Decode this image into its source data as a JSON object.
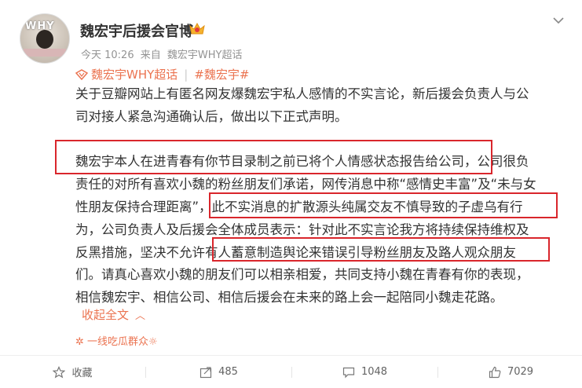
{
  "post": {
    "author": "魏宏宇后援会官博",
    "avatar_text": "WHY",
    "time": "今天 10:26",
    "source_prefix": "来自",
    "source": "魏宏宇WHY超话",
    "topics": [
      "魏宏宇WHY超话",
      "#魏宏宇#"
    ],
    "paragraph1_line1": "关于豆瓣网站上有匿名网友爆魏宏宇私人感情的不实言论，新后援会负责人与公",
    "paragraph1_line2": "司对接人紧急沟通确认后，做出以下正式声明。",
    "p2_lines": [
      "魏宏宇本人在进青春有你节目录制之前已将个人情感状态报告给公司，公司很负",
      "责任的对所有喜欢小魏的粉丝朋友们承诺，网传消息中称“感情史丰富”及“未与女",
      "性朋友保持合理距离”，此不实消息的扩散源头纯属交友不慎导致的子虚乌有行",
      "为，公司负责人及后援会全体成员表示：针对此不实言论我方将持续保持维权及",
      "反黑措施，坚决不允许有人蓄意制造舆论来错误引导粉丝朋友及路人观众朋友",
      "们。请真心喜欢小魏的朋友们可以相亲相爱，共同支持小魏在青春有你的表现，",
      "相信魏宏宇、相信公司、相信后援会在未来的路上会一起陪同小魏走花路。"
    ],
    "collapse_label": "收起全文",
    "footnote": "一线吃瓜群众☼"
  },
  "actions": {
    "favorite": "收藏",
    "repost": "485",
    "comment": "1048",
    "like": "7029"
  },
  "colors": {
    "accent": "#eb7350",
    "highlight_box": "#d9262c"
  }
}
